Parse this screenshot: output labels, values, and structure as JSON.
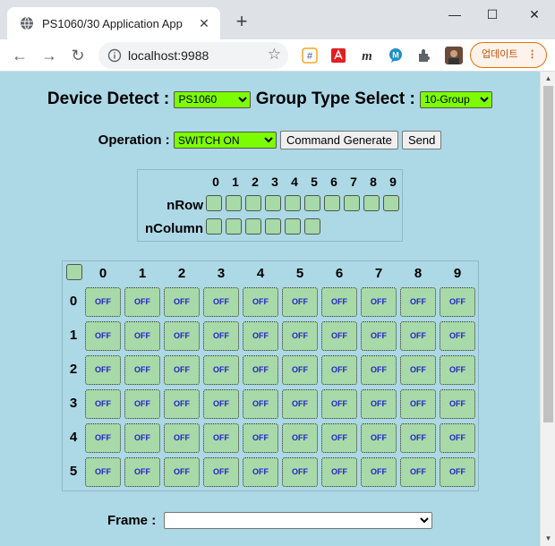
{
  "browser": {
    "tab_title": "PS1060/30 Application App",
    "url": "localhost:9988",
    "update_label": "업데이트",
    "icons": [
      "globe-icon",
      "close-icon",
      "new-tab-icon",
      "minimize-icon",
      "maximize-icon",
      "window-close-icon",
      "back-icon",
      "forward-icon",
      "reload-icon",
      "info-icon",
      "bookmark-star-icon",
      "extension-icon",
      "more-icon"
    ]
  },
  "form": {
    "device_label": "Device Detect :",
    "device_value": "PS1060",
    "group_label": "Group Type Select :",
    "group_value": "10-Group",
    "operation_label": "Operation :",
    "operation_value": "SWITCH ON",
    "command_button": "Command Generate",
    "send_button": "Send"
  },
  "group_panel": {
    "columns": [
      "0",
      "1",
      "2",
      "3",
      "4",
      "5",
      "6",
      "7",
      "8",
      "9"
    ],
    "nrow_label": "nRow",
    "ncolumn_label": "nColumn",
    "nrow_checkbox_count": 10,
    "ncolumn_checkbox_count": 6
  },
  "grid": {
    "columns": [
      "0",
      "1",
      "2",
      "3",
      "4",
      "5",
      "6",
      "7",
      "8",
      "9"
    ],
    "rows": [
      "0",
      "1",
      "2",
      "3",
      "4",
      "5"
    ],
    "cell_state": "OFF"
  },
  "frame": {
    "label": "Frame :",
    "value": ""
  },
  "colors": {
    "page_bg": "#add8e6",
    "select_green": "#7cfc00",
    "cell_green": "#a8d9a8",
    "cell_text": "#2323c8"
  }
}
